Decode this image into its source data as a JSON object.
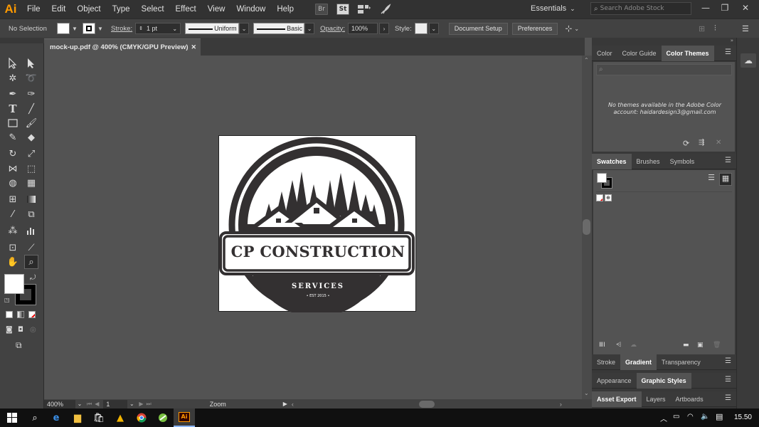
{
  "app": {
    "logo": "Ai",
    "menu": [
      "File",
      "Edit",
      "Object",
      "Type",
      "Select",
      "Effect",
      "View",
      "Window",
      "Help"
    ],
    "bridge_label": "Br",
    "stock_label": "St",
    "workspace": "Essentials",
    "search_placeholder": "Search Adobe Stock"
  },
  "controlbar": {
    "selection": "No Selection",
    "stroke_label": "Stroke:",
    "stroke_weight": "1 pt",
    "stroke_profile": "Uniform",
    "brush": "Basic",
    "opacity_label": "Opacity:",
    "opacity_value": "100%",
    "style_label": "Style:",
    "document_setup": "Document Setup",
    "preferences": "Preferences"
  },
  "document": {
    "tab_title": "mock-up.pdf @ 400% (CMYK/GPU Preview)",
    "zoom": "400%",
    "artboard_number": "1",
    "status_tool": "Zoom"
  },
  "artwork": {
    "company": "CP CONSTRUCTION",
    "services": "SERVICES",
    "est": "• EST 2015 •",
    "ink_color": "#333031"
  },
  "panels": {
    "color_tabs": [
      "Color",
      "Color Guide",
      "Color Themes"
    ],
    "color_themes_message": "No themes available in the Adobe Color account: haidardesign3@gmail.com",
    "swatches_tabs": [
      "Swatches",
      "Brushes",
      "Symbols"
    ],
    "stroke_tabs": [
      "Stroke",
      "Gradient",
      "Transparency"
    ],
    "appearance_tabs": [
      "Appearance",
      "Graphic Styles"
    ],
    "export_tabs": [
      "Asset Export",
      "Layers",
      "Artboards"
    ]
  },
  "taskbar": {
    "time": "15.50"
  }
}
